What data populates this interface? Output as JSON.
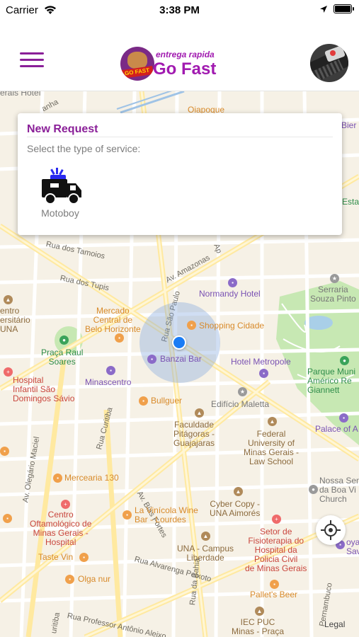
{
  "status_bar": {
    "carrier": "Carrier",
    "time": "3:38 PM"
  },
  "header": {
    "menu_icon": "hamburger-menu-icon",
    "logo": {
      "tagline": "entrega rapida",
      "brand": "Go Fast",
      "badge": "GO FAST"
    },
    "avatar_icon": "user-avatar"
  },
  "request_card": {
    "title": "New Request",
    "subtitle": "Select the type of service:",
    "services": [
      {
        "label": "Motoboy",
        "icon": "delivery-truck-icon"
      }
    ]
  },
  "map": {
    "labels": {
      "gerais_hotel": "erais Hotel",
      "anha": "anha",
      "oiapoque": "Oiapoque",
      "bier": "Bier",
      "esta": "Estac",
      "av_amazonas": "Av. Amazonas",
      "rua_tamoios": "Rua dos Tamoios",
      "rua_tupis": "Rua dos Tupis",
      "normandy": "Normandy Hotel",
      "serraria": "Serraria\nSouza Pinto",
      "ap": "Ap",
      "centro_universitario": "entro\nersitário\nUNA",
      "mercado": "Mercado\nCentral de\nBelo Horizonte",
      "rua_sao_paulo": "Rua São Paulo",
      "shopping": "Shopping Cidade",
      "praca_raul": "Praça Raul\nSoares",
      "banzai": "Banzai Bar",
      "hotel_metropole": "Hotel Metropole",
      "parque": "Parque Muni\nAmérico Re\nGiannett",
      "hospital_infantil": "Hospital\nInfantil São\nDomingos Sávio",
      "minascentro": "Minascentro",
      "bullguer": "Bullguer",
      "edificio": "Edifício Maletta",
      "palace": "Palace of A",
      "rua_curitiba": "Rua Curitiba",
      "faculdade": "Faculdade\nPitágoras -\nGuajajaras",
      "federal": "Federal\nUniversity of\nMinas Gerais -\nLaw School",
      "av_olegario": "Av. Olegário Maciel",
      "mercearia": "Mercearia 130",
      "av_bias": "Av. Bias Fortes",
      "nossa": "Nossa Sen\nda Boa Vi\nChurch",
      "cyber_copy": "Cyber Copy -\nUNA Aimorés",
      "centro_oftalmo": "Centro\nOftamológico de\nMinas Gerais -\nHospital",
      "la_vinicola": "La Vinícola Wine\nBar - Lourdes",
      "setor": "Setor de\nFisioterapia do\nHospital da\nPolicia Civil\nde Minas Gerais",
      "royal": "oyal\nSavass",
      "taste_vin": "Taste Vin",
      "rua_alvarenga": "Rua Alvarenga Peixoto",
      "una_campus": "UNA - Campus\nLiberdade",
      "olga": "Olga nur",
      "pallets": "Pallet's Beer",
      "rua_bahia": "Rua da Bahia",
      "rua_professor": "Rua Professor Antônio Aleixo",
      "iec_puc": "IEC PUC\nMinas - Praça\nda Liberdade",
      "pernambuco": "Pernambuco",
      "uritiba": "uritiba"
    },
    "legal": "Legal",
    "locate_icon": "current-location-icon"
  }
}
